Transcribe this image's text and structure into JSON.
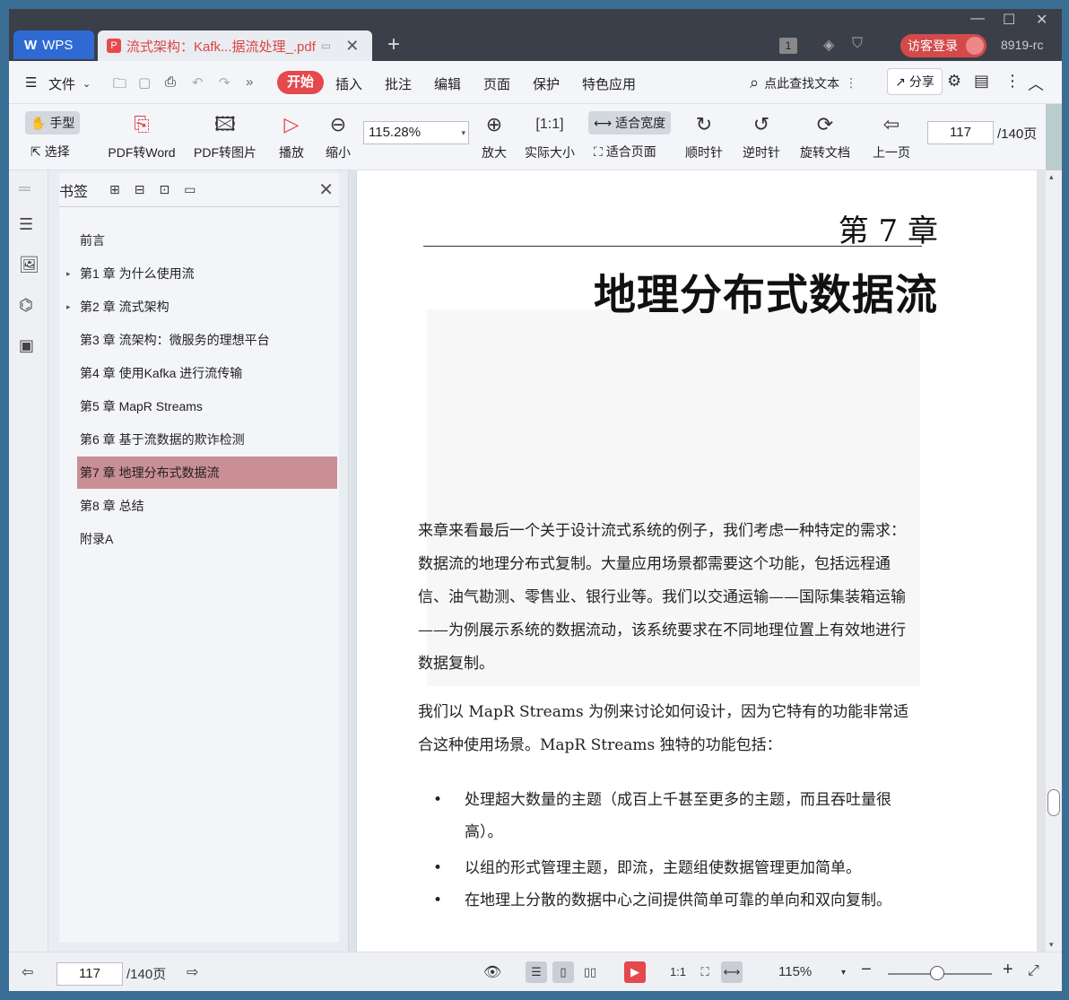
{
  "titlebar": {
    "app": "WPS",
    "doc_tab": "流式架构：Kafk...据流处理_.pdf",
    "page_badge": "1",
    "login": "访客登录",
    "user": "8919-rc"
  },
  "menu": {
    "file": "文件",
    "start": "开始",
    "items": [
      "插入",
      "批注",
      "编辑",
      "页面",
      "保护",
      "特色应用"
    ],
    "search": "点此查找文本",
    "share": "分享"
  },
  "toolbar": {
    "hand": "手型",
    "select": "选择",
    "pdf2word": "PDF转Word",
    "pdf2img": "PDF转图片",
    "play": "播放",
    "zoom_out": "缩小",
    "zoom": "115.28%",
    "zoom_in": "放大",
    "actual": "实际大小",
    "fit_width": "适合宽度",
    "fit_page": "适合页面",
    "cw": "顺时针",
    "ccw": "逆时针",
    "rotate": "旋转文档",
    "prev": "上一页",
    "page": "117",
    "total": "/140页"
  },
  "bookmarks": {
    "title": "书签",
    "items": [
      "前言",
      "第1 章 为什么使用流",
      "第2 章 流式架构",
      "第3 章 流架构：微服务的理想平台",
      "第4 章 使用Kafka 进行流传输",
      "第5 章 MapR Streams",
      "第6 章 基于流数据的欺诈检测",
      "第7 章 地理分布式数据流",
      "第8 章 总结",
      "附录A"
    ],
    "selected": 7
  },
  "content": {
    "chapter": "第 7 章",
    "title": "地理分布式数据流",
    "p1": "来章来看最后一个关于设计流式系统的例子，我们考虑一种特定的需求：数据流的地理分布式复制。大量应用场景都需要这个功能，包括远程通信、油气勘测、零售业、银行业等。我们以交通运输——国际集装箱运输——为例展示系统的数据流动，该系统要求在不同地理位置上有效地进行数据复制。",
    "p2": "我们以 MapR Streams 为例来讨论如何设计，因为它特有的功能非常适合这种使用场景。MapR Streams 独特的功能包括：",
    "b1": "处理超大数量的主题（成百上千甚至更多的主题，而且吞吐量很高）。",
    "b2": "以组的形式管理主题，即流，主题组使数据管理更加简单。",
    "b3": "在地理上分散的数据中心之间提供简单可靠的单向和双向复制。"
  },
  "status": {
    "page": "117",
    "total": "/140页",
    "zoom": "115%"
  }
}
